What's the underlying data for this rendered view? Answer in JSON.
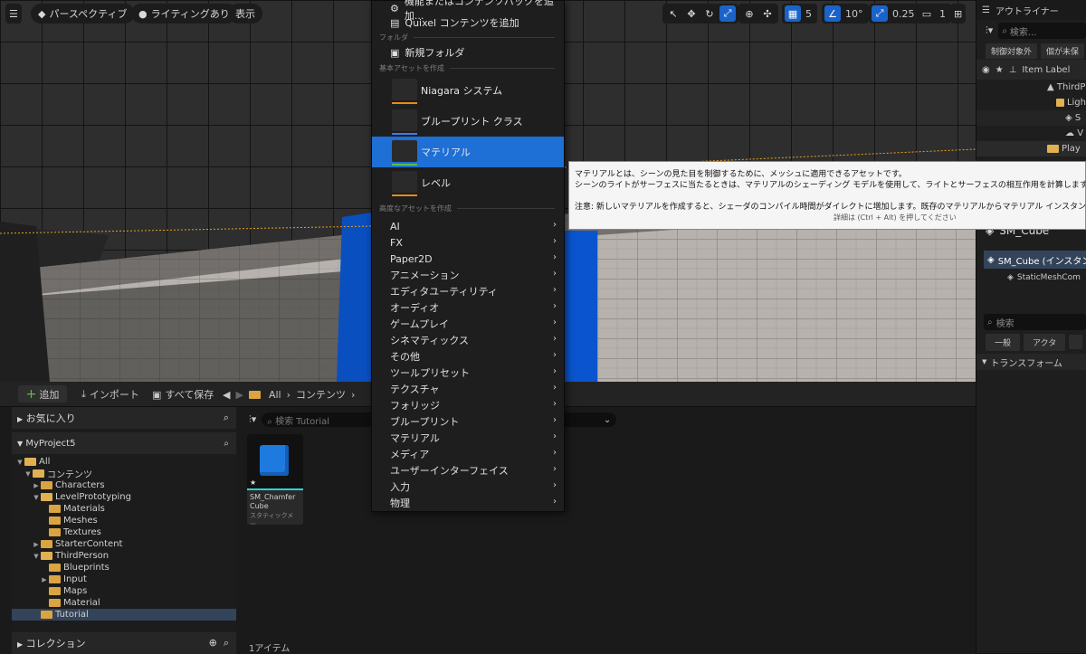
{
  "viewport": {
    "menu_icon": "hamburger-icon",
    "perspective_label": "パースペクティブ",
    "lighting_label": "ライティングあり",
    "show_label": "表示",
    "grid_value": "5",
    "angle_value": "10°",
    "scale_value": "0.25",
    "camera_speed": "1"
  },
  "outliner": {
    "title": "アウトライナー",
    "search_placeholder": "検索...",
    "buttons": [
      "制御対象外",
      "個が未保"
    ],
    "item_label_header": "Item Label",
    "items": [
      "ThirdP",
      "Ligh",
      "S",
      "V",
      "Play"
    ],
    "details_object": "SM_Cube",
    "details_component_root": "SM_Cube (インスタン",
    "details_component_child": "StaticMeshCom",
    "details_search_placeholder": "検索",
    "details_tabs": [
      "一般",
      "アクタ"
    ],
    "transform_section": "トランスフォーム"
  },
  "content_browser": {
    "add_label": "追加",
    "import_label": "インポート",
    "save_all_label": "すべて保存",
    "breadcrumb": [
      "All",
      "コンテンツ"
    ],
    "favorites_label": "お気に入り",
    "project_label": "MyProject5",
    "tree": [
      {
        "label": "All",
        "level": 0,
        "open": true
      },
      {
        "label": "コンテンツ",
        "level": 1,
        "open": true
      },
      {
        "label": "Characters",
        "level": 2,
        "open": false,
        "expander": true
      },
      {
        "label": "LevelPrototyping",
        "level": 2,
        "open": true
      },
      {
        "label": "Materials",
        "level": 3,
        "open": false
      },
      {
        "label": "Meshes",
        "level": 3,
        "open": false
      },
      {
        "label": "Textures",
        "level": 3,
        "open": false
      },
      {
        "label": "StarterContent",
        "level": 2,
        "open": false,
        "expander": true
      },
      {
        "label": "ThirdPerson",
        "level": 2,
        "open": true
      },
      {
        "label": "Blueprints",
        "level": 3,
        "open": false
      },
      {
        "label": "Input",
        "level": 3,
        "open": false,
        "expander": true
      },
      {
        "label": "Maps",
        "level": 3,
        "open": false
      },
      {
        "label": "Material",
        "level": 3,
        "open": false
      },
      {
        "label": "Tutorial",
        "level": 2,
        "open": false,
        "selected": true
      }
    ],
    "collections_label": "コレクション",
    "search_placeholder": "検索 Tutorial",
    "asset_name_line1": "SM_Chamfer",
    "asset_name_line2": "Cube",
    "asset_type": "スタティックメッ...",
    "item_count": "1アイテム"
  },
  "menu": {
    "top_items": [
      "機能またはコンテンツパックを追加...",
      "Quixel コンテンツを追加"
    ],
    "folder_section": "フォルダ",
    "new_folder": "新規フォルダ",
    "basic_section": "基本アセットを作成",
    "basic_items": [
      {
        "label": "Niagara システム",
        "icon": "niagara-icon",
        "bar_color": "#e88a1c"
      },
      {
        "label": "ブループリント クラス",
        "icon": "blueprint-icon",
        "bar_color": "#3f7be8"
      },
      {
        "label": "マテリアル",
        "icon": "material-icon",
        "bar_color": "#5fbf3f",
        "selected": true
      },
      {
        "label": "レベル",
        "icon": "level-icon",
        "bar_color": "#e88a1c"
      }
    ],
    "advanced_section": "高度なアセットを作成",
    "submenus": [
      "AI",
      "FX",
      "Paper2D",
      "アニメーション",
      "エディタユーティリティ",
      "オーディオ",
      "ゲームプレイ",
      "シネマティックス",
      "その他",
      "ツールプリセット",
      "テクスチャ",
      "フォリッジ",
      "ブループリント",
      "マテリアル",
      "メディア",
      "ユーザーインターフェイス",
      "入力",
      "物理"
    ]
  },
  "tooltip": {
    "line1": "マテリアルとは、シーンの見た目を制御するために、メッシュに適用できるアセットです。",
    "line2": "シーンのライトがサーフェスに当たるときは、マテリアルのシェーディング モデルを使用して、ライトとサーフェスの相互作用を計算します。",
    "line3": "注意: 新しいマテリアルを作成すると、シェーダのコンパイル時間がダイレクトに増加します。既存のマテリアルからマテリアル インスタンス",
    "line4": "詳細は (Ctrl + Alt) を押してください"
  },
  "colors": {
    "accent": "#1e6fd6",
    "folder": "#d9a441",
    "add_button": "#5fbf3f"
  }
}
